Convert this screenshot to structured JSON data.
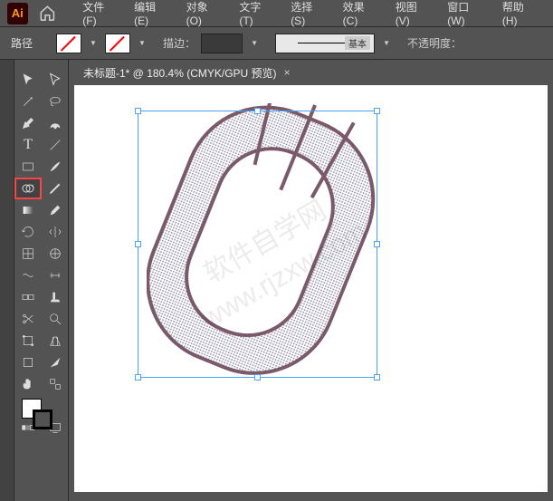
{
  "app": {
    "abbr": "Ai"
  },
  "menu": {
    "file": "文件(F)",
    "edit": "编辑(E)",
    "object": "对象(O)",
    "type": "文字(T)",
    "select": "选择(S)",
    "effect": "效果(C)",
    "view": "视图(V)",
    "window": "窗口(W)",
    "help": "帮助(H)"
  },
  "control": {
    "mode": "路径",
    "stroke_label": "描边：",
    "brush_label": "基本",
    "opacity_label": "不透明度："
  },
  "doc": {
    "tab_label": "未标题-1* @ 180.4% (CMYK/GPU 预览)",
    "close": "×"
  },
  "watermark": "软件自学网\nwww.rjzxw.com"
}
